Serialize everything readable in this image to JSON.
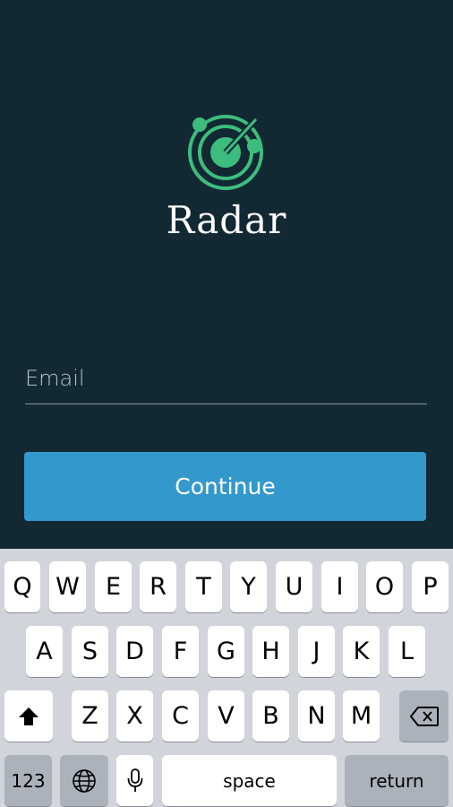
{
  "app": {
    "brand_name": "Radar",
    "accent_color": "#3399cc",
    "logo_color": "#3dbd7d",
    "background_color": "#122833",
    "email": {
      "placeholder": "Email",
      "value": ""
    },
    "continue_label": "Continue"
  },
  "keyboard": {
    "row1": [
      "Q",
      "W",
      "E",
      "R",
      "T",
      "Y",
      "U",
      "I",
      "O",
      "P"
    ],
    "row2": [
      "A",
      "S",
      "D",
      "F",
      "G",
      "H",
      "J",
      "K",
      "L"
    ],
    "row3": [
      "Z",
      "X",
      "C",
      "V",
      "B",
      "N",
      "M"
    ],
    "numbers_label": "123",
    "space_label": "space",
    "return_label": "return",
    "icons": {
      "shift": "shift-icon",
      "delete": "delete-icon",
      "globe": "globe-icon",
      "mic": "microphone-icon"
    }
  }
}
